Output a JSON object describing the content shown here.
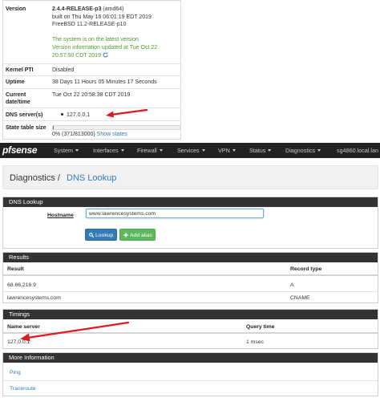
{
  "status": {
    "version_label": "Version",
    "version_line1": "2.4.4-RELEASE-p3",
    "version_arch": " (amd64)",
    "version_line2": "built on Thu May 16 06:01:19 EDT 2019",
    "version_line3": "FreeBSD 11.2-RELEASE-p10",
    "version_latest": "The system is on the latest version.",
    "version_info1": "Version information updated at Tue Oct 22",
    "version_info2": "20:57:50 CDT 2019",
    "kernel_pti_label": "Kernel PTI",
    "kernel_pti_value": "Disabled",
    "uptime_label": "Uptime",
    "uptime_value": "38 Days 11 Hours 05 Minutes 17 Seconds",
    "current_datetime_label1": "Current",
    "current_datetime_label2": "date/time",
    "current_datetime_value": "Tue Oct 22 20:58:38 CDT 2019",
    "dns_label": "DNS server(s)",
    "dns_value": "127.0.0.1",
    "state_label": "State table size",
    "state_value": "0% (371/813000) ",
    "state_link": "Show states",
    "state_fraction": 0.0005
  },
  "navbar": {
    "logo_pf": "pf",
    "logo_sense": "sense",
    "items": [
      "System",
      "Interfaces",
      "Firewall",
      "Services",
      "VPN",
      "Status",
      "Diagnostics"
    ],
    "host": "sg4860.local.lan"
  },
  "breadcrumb": {
    "parent": "Diagnostics /",
    "current": "DNS Lookup"
  },
  "dns_lookup": {
    "title": "DNS Lookup",
    "hostname_label": "Hostname",
    "hostname_value": "www.lawrencesystems.com",
    "lookup_label": "Lookup",
    "add_alias_label": "Add alias"
  },
  "results": {
    "title": "Results",
    "headers": [
      "Result",
      "Record type"
    ],
    "rows": [
      [
        "68.66.216.9",
        "A"
      ],
      [
        "lawrencesystems.com",
        "CNAME"
      ]
    ]
  },
  "timings": {
    "title": "Timings",
    "headers": [
      "Name server",
      "Query time"
    ],
    "rows": [
      [
        "127.0.0.1",
        "1 msec"
      ]
    ]
  },
  "more_info": {
    "title": "More Information",
    "links": [
      "Ping",
      "Traceroute"
    ]
  },
  "colors": {
    "arrow": "#e01b1b",
    "navbar": "#222222",
    "panel_head": "#333333",
    "link": "#337ab7",
    "lookup_button": "#337ab7",
    "alias_button": "#5cb85c",
    "latest_text": "#4e9a2e"
  }
}
